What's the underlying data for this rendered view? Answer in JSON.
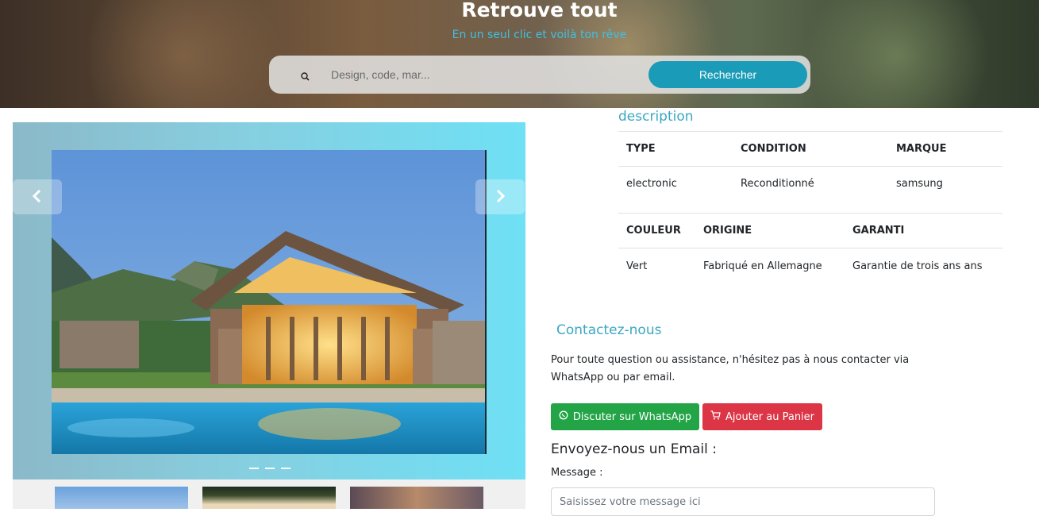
{
  "hero": {
    "title": "Retrouve tout",
    "subtitle": "En un seul clic et voilà ton rêve",
    "search_placeholder": "Design, code, mar...",
    "search_button": "Rechercher",
    "search_icon": "search-icon"
  },
  "carousel": {
    "prev_icon": "chevron-left-icon",
    "next_icon": "chevron-right-icon",
    "indicator_count": 3,
    "thumbnails": [
      "house-thumbnail",
      "palm-beach-thumbnail",
      "sunset-thumbnail"
    ]
  },
  "description": {
    "title": "description",
    "table1": {
      "headers": [
        "TYPE",
        "CONDITION",
        "MARQUE"
      ],
      "values": [
        "electronic",
        "Reconditionné",
        "samsung"
      ]
    },
    "table2": {
      "headers": [
        "COULEUR",
        "ORIGINE",
        "GARANTI"
      ],
      "values": [
        "Vert",
        "Fabriqué en Allemagne",
        "Garantie de trois ans ans"
      ]
    }
  },
  "contact": {
    "title": "Contactez-nous",
    "text": "Pour toute question ou assistance, n'hésitez pas à nous contacter via WhatsApp ou par email.",
    "whatsapp_button": "Discuter sur WhatsApp",
    "cart_button": "Ajouter au Panier",
    "email_title": "Envoyez-nous un Email :",
    "message_label": "Message :",
    "message_placeholder": "Saisissez votre message ici"
  },
  "colors": {
    "accent": "#3aa8c1",
    "search_button": "#1a9bb7",
    "whatsapp": "#22a447",
    "cart": "#dc3545"
  }
}
